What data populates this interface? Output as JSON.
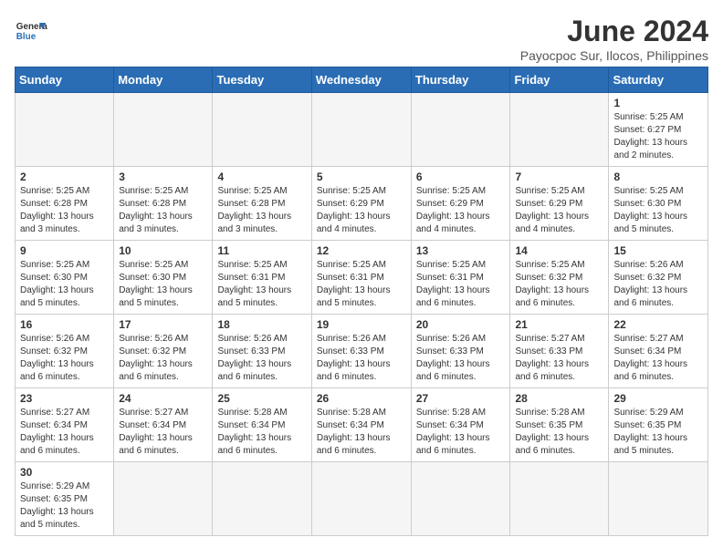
{
  "header": {
    "logo_general": "General",
    "logo_blue": "Blue",
    "month_title": "June 2024",
    "subtitle": "Payocpoc Sur, Ilocos, Philippines"
  },
  "days_of_week": [
    "Sunday",
    "Monday",
    "Tuesday",
    "Wednesday",
    "Thursday",
    "Friday",
    "Saturday"
  ],
  "weeks": [
    [
      {
        "day": "",
        "info": ""
      },
      {
        "day": "",
        "info": ""
      },
      {
        "day": "",
        "info": ""
      },
      {
        "day": "",
        "info": ""
      },
      {
        "day": "",
        "info": ""
      },
      {
        "day": "",
        "info": ""
      },
      {
        "day": "1",
        "info": "Sunrise: 5:25 AM\nSunset: 6:27 PM\nDaylight: 13 hours and 2 minutes."
      }
    ],
    [
      {
        "day": "2",
        "info": "Sunrise: 5:25 AM\nSunset: 6:28 PM\nDaylight: 13 hours and 3 minutes."
      },
      {
        "day": "3",
        "info": "Sunrise: 5:25 AM\nSunset: 6:28 PM\nDaylight: 13 hours and 3 minutes."
      },
      {
        "day": "4",
        "info": "Sunrise: 5:25 AM\nSunset: 6:28 PM\nDaylight: 13 hours and 3 minutes."
      },
      {
        "day": "5",
        "info": "Sunrise: 5:25 AM\nSunset: 6:29 PM\nDaylight: 13 hours and 4 minutes."
      },
      {
        "day": "6",
        "info": "Sunrise: 5:25 AM\nSunset: 6:29 PM\nDaylight: 13 hours and 4 minutes."
      },
      {
        "day": "7",
        "info": "Sunrise: 5:25 AM\nSunset: 6:29 PM\nDaylight: 13 hours and 4 minutes."
      },
      {
        "day": "8",
        "info": "Sunrise: 5:25 AM\nSunset: 6:30 PM\nDaylight: 13 hours and 5 minutes."
      }
    ],
    [
      {
        "day": "9",
        "info": "Sunrise: 5:25 AM\nSunset: 6:30 PM\nDaylight: 13 hours and 5 minutes."
      },
      {
        "day": "10",
        "info": "Sunrise: 5:25 AM\nSunset: 6:30 PM\nDaylight: 13 hours and 5 minutes."
      },
      {
        "day": "11",
        "info": "Sunrise: 5:25 AM\nSunset: 6:31 PM\nDaylight: 13 hours and 5 minutes."
      },
      {
        "day": "12",
        "info": "Sunrise: 5:25 AM\nSunset: 6:31 PM\nDaylight: 13 hours and 5 minutes."
      },
      {
        "day": "13",
        "info": "Sunrise: 5:25 AM\nSunset: 6:31 PM\nDaylight: 13 hours and 6 minutes."
      },
      {
        "day": "14",
        "info": "Sunrise: 5:25 AM\nSunset: 6:32 PM\nDaylight: 13 hours and 6 minutes."
      },
      {
        "day": "15",
        "info": "Sunrise: 5:26 AM\nSunset: 6:32 PM\nDaylight: 13 hours and 6 minutes."
      }
    ],
    [
      {
        "day": "16",
        "info": "Sunrise: 5:26 AM\nSunset: 6:32 PM\nDaylight: 13 hours and 6 minutes."
      },
      {
        "day": "17",
        "info": "Sunrise: 5:26 AM\nSunset: 6:32 PM\nDaylight: 13 hours and 6 minutes."
      },
      {
        "day": "18",
        "info": "Sunrise: 5:26 AM\nSunset: 6:33 PM\nDaylight: 13 hours and 6 minutes."
      },
      {
        "day": "19",
        "info": "Sunrise: 5:26 AM\nSunset: 6:33 PM\nDaylight: 13 hours and 6 minutes."
      },
      {
        "day": "20",
        "info": "Sunrise: 5:26 AM\nSunset: 6:33 PM\nDaylight: 13 hours and 6 minutes."
      },
      {
        "day": "21",
        "info": "Sunrise: 5:27 AM\nSunset: 6:33 PM\nDaylight: 13 hours and 6 minutes."
      },
      {
        "day": "22",
        "info": "Sunrise: 5:27 AM\nSunset: 6:34 PM\nDaylight: 13 hours and 6 minutes."
      }
    ],
    [
      {
        "day": "23",
        "info": "Sunrise: 5:27 AM\nSunset: 6:34 PM\nDaylight: 13 hours and 6 minutes."
      },
      {
        "day": "24",
        "info": "Sunrise: 5:27 AM\nSunset: 6:34 PM\nDaylight: 13 hours and 6 minutes."
      },
      {
        "day": "25",
        "info": "Sunrise: 5:28 AM\nSunset: 6:34 PM\nDaylight: 13 hours and 6 minutes."
      },
      {
        "day": "26",
        "info": "Sunrise: 5:28 AM\nSunset: 6:34 PM\nDaylight: 13 hours and 6 minutes."
      },
      {
        "day": "27",
        "info": "Sunrise: 5:28 AM\nSunset: 6:34 PM\nDaylight: 13 hours and 6 minutes."
      },
      {
        "day": "28",
        "info": "Sunrise: 5:28 AM\nSunset: 6:35 PM\nDaylight: 13 hours and 6 minutes."
      },
      {
        "day": "29",
        "info": "Sunrise: 5:29 AM\nSunset: 6:35 PM\nDaylight: 13 hours and 5 minutes."
      }
    ],
    [
      {
        "day": "30",
        "info": "Sunrise: 5:29 AM\nSunset: 6:35 PM\nDaylight: 13 hours and 5 minutes."
      },
      {
        "day": "",
        "info": ""
      },
      {
        "day": "",
        "info": ""
      },
      {
        "day": "",
        "info": ""
      },
      {
        "day": "",
        "info": ""
      },
      {
        "day": "",
        "info": ""
      },
      {
        "day": "",
        "info": ""
      }
    ]
  ]
}
